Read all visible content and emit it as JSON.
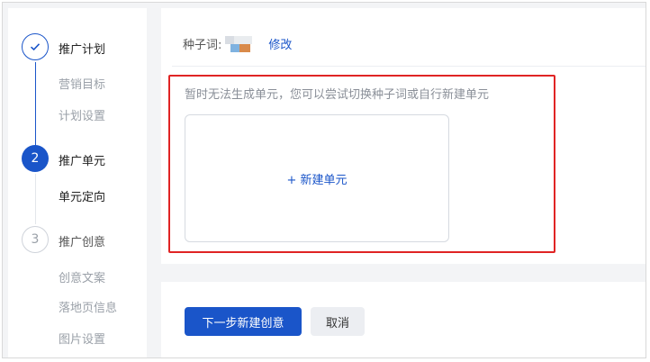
{
  "sidebar": {
    "steps": [
      {
        "label": "推广计划",
        "icon": "check-icon",
        "state": "done"
      },
      {
        "label": "推广单元",
        "number": "2",
        "state": "active"
      },
      {
        "label": "推广创意",
        "number": "3",
        "state": "todo"
      }
    ],
    "sub_items": {
      "plan": [
        "营销目标",
        "计划设置"
      ],
      "unit": [
        "单元定向"
      ],
      "creative": [
        "创意文案",
        "落地页信息",
        "图片设置"
      ]
    }
  },
  "seed": {
    "label": "种子词:",
    "edit_label": "修改"
  },
  "notice": "暂时无法生成单元，您可以尝试切换种子词或自行新建单元",
  "new_unit_label": "+ 新建单元",
  "actions": {
    "next_label": "下一步新建创意",
    "cancel_label": "取消"
  },
  "colors": {
    "accent": "#1a55c9",
    "highlight_border": "#e02424"
  }
}
